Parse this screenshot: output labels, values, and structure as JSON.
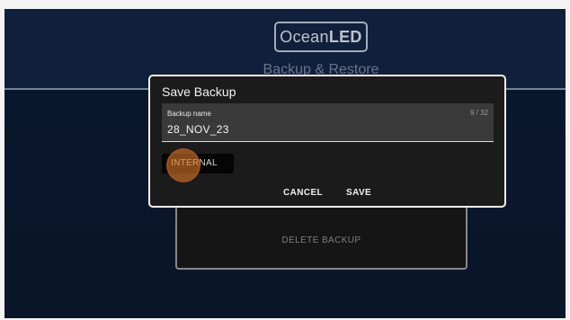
{
  "header": {
    "logo_text_a": "Ocean",
    "logo_text_b": "LED",
    "title": "Backup & Restore"
  },
  "background_panel": {
    "delete_label": "DELETE BACKUP"
  },
  "dialog": {
    "title": "Save Backup",
    "field": {
      "label": "Backup name",
      "value": "28_NOV_23",
      "counter": "9 / 32"
    },
    "location_button": "INTERNAL",
    "cancel_label": "CANCEL",
    "save_label": "SAVE"
  },
  "colors": {
    "background": "#14284a",
    "dialog_bg": "#1b1b1b",
    "dialog_border": "#f0f0f0",
    "tap_indicator": "#d67628"
  }
}
